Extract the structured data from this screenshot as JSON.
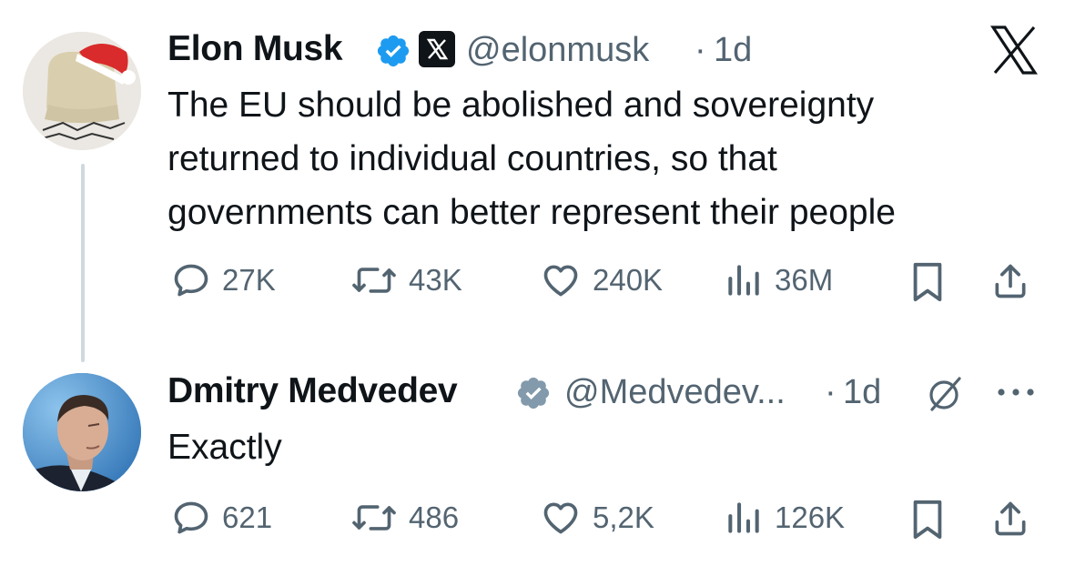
{
  "tweets": [
    {
      "author_name": "Elon Musk",
      "handle": "@elonmusk",
      "separator": "·",
      "time": "1d",
      "verified": "blue-check",
      "affiliate_badge": "x-logo",
      "text_lines": [
        "The EU should be abolished and sovereignty",
        "returned to individual countries, so that",
        "governments can better represent their people"
      ],
      "stats": {
        "replies": "27K",
        "reposts": "43K",
        "likes": "240K",
        "views": "36M"
      }
    },
    {
      "author_name": "Dmitry Medvedev",
      "handle": "@Medvedev...",
      "separator": "·",
      "time": "1d",
      "verified": "gray-check",
      "text": "Exactly",
      "stats": {
        "replies": "621",
        "reposts": "486",
        "likes": "5,2K",
        "views": "126K"
      }
    }
  ],
  "colors": {
    "text": "#0f1419",
    "secondary": "#536471",
    "verified_blue": "#1d9bf0",
    "verified_gray": "#829aab",
    "thread_line": "#cfd9de"
  },
  "icons": [
    "x-logo-icon",
    "grok-icon",
    "more-icon",
    "reply-icon",
    "repost-icon",
    "like-icon",
    "views-icon",
    "bookmark-icon",
    "share-icon"
  ]
}
